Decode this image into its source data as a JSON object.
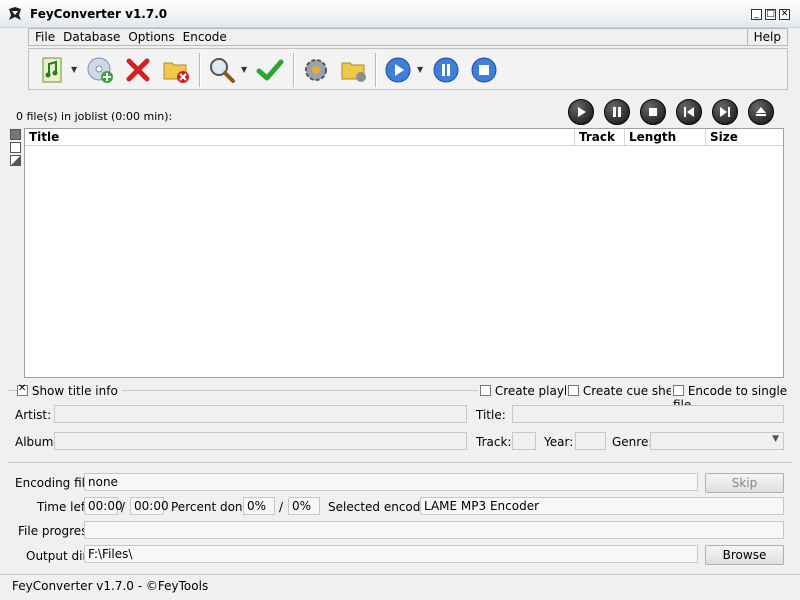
{
  "window": {
    "title": "FeyConverter v1.7.0"
  },
  "menu": {
    "items": [
      "File",
      "Database",
      "Options",
      "Encode"
    ],
    "help": "Help"
  },
  "toolbar": {
    "icons": [
      "add-music-icon",
      "add-cd-icon",
      "remove-icon",
      "clear-folder-icon",
      "search-icon",
      "check-icon",
      "settings-icon",
      "output-folder-icon",
      "play-encode-icon",
      "pause-encode-icon",
      "stop-encode-icon"
    ]
  },
  "joblist": {
    "count_text": "0 file(s) in joblist (0:00 min):",
    "columns": [
      "Title",
      "Track",
      "Length",
      "Size"
    ]
  },
  "info": {
    "show_title_info": "Show title info",
    "create_playlist": "Create playlist",
    "create_cue_sheet": "Create cue sheet",
    "encode_single_file": "Encode to single file",
    "artist_label": "Artist:",
    "title_label": "Title:",
    "album_label": "Album:",
    "track_label": "Track:",
    "year_label": "Year:",
    "genre_label": "Genre:"
  },
  "encoding": {
    "encoding_file_label": "Encoding file:",
    "encoding_file_value": "none",
    "skip_label": "Skip",
    "time_left_label": "Time left:",
    "time_left_1": "00:00",
    "time_left_2": "00:00",
    "slash": "/",
    "percent_done_label": "Percent done:",
    "percent_1": "0%",
    "percent_2": "0%",
    "selected_encoder_label": "Selected encoder:",
    "selected_encoder_value": "LAME MP3 Encoder",
    "file_progress_label": "File progress:",
    "file_progress": 0,
    "output_dir_label": "Output dir.:",
    "output_dir_value": "F:\\Files\\",
    "browse_label": "Browse"
  },
  "statusbar": {
    "text": "FeyConverter v1.7.0 - ©FeyTools"
  }
}
